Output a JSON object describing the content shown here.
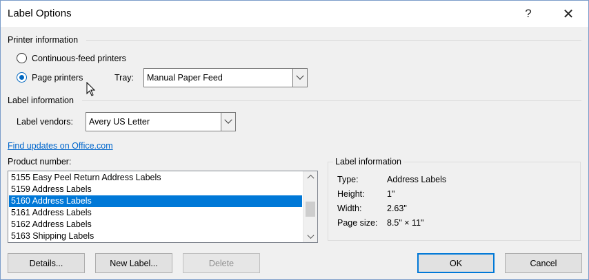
{
  "window": {
    "title": "Label Options",
    "help": "?",
    "close": "✕"
  },
  "printer_info": {
    "heading": "Printer information",
    "continuous_label": "Continuous-feed printers",
    "page_label": "Page printers",
    "tray_label": "Tray:",
    "tray_value": "Manual Paper Feed"
  },
  "label_info": {
    "heading": "Label information",
    "vendors_label": "Label vendors:",
    "vendors_value": "Avery US Letter"
  },
  "link": "Find updates on Office.com",
  "product": {
    "label": "Product number:",
    "items": [
      "5155 Easy Peel Return Address Labels",
      "5159 Address Labels",
      "5160 Address Labels",
      "5161 Address Labels",
      "5162 Address Labels",
      "5163 Shipping Labels"
    ],
    "selected_index": 2
  },
  "details_box": {
    "title": "Label information",
    "rows": [
      {
        "key": "Type:",
        "value": "Address Labels"
      },
      {
        "key": "Height:",
        "value": "1\""
      },
      {
        "key": "Width:",
        "value": "2.63\""
      },
      {
        "key": "Page size:",
        "value": "8.5\" × 11\""
      }
    ]
  },
  "buttons": {
    "details": "Details...",
    "new_label": "New Label...",
    "delete": "Delete",
    "ok": "OK",
    "cancel": "Cancel"
  }
}
